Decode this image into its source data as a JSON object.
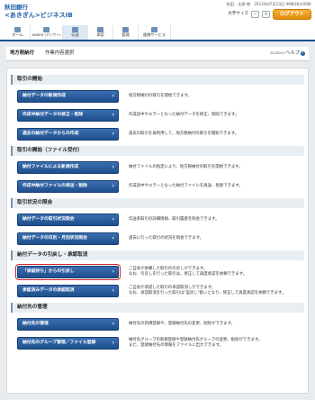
{
  "header": {
    "bank_name": "秋田銀行",
    "service_name": "<あきぎん>ビジネスIB",
    "user_line": "秋田　太郎 様　2012年07月13日 09時30分00秒",
    "font_size_label": "文字サイズ",
    "font_minus": "－",
    "font_plus": "＋",
    "logout": "ログアウト"
  },
  "nav": [
    {
      "label": "ホーム",
      "icon": "home-icon"
    },
    {
      "label": "ANSER (アンサー)",
      "icon": "anser-icon"
    },
    {
      "label": "伝送",
      "icon": "transfer-icon"
    },
    {
      "label": "承認",
      "icon": "approval-icon"
    },
    {
      "label": "管理",
      "icon": "management-icon"
    },
    {
      "label": "連携サービス",
      "icon": "link-service-icon"
    }
  ],
  "titlebar": {
    "breadcrumb": "地方税納付",
    "page_title": "作業内容選択",
    "screen_id": "BCZK001",
    "help": "ヘルプ",
    "help_icon": "?"
  },
  "sections": [
    {
      "title": "取引の開始",
      "rows": [
        {
          "button": "納付データの新規作成",
          "desc": [
            "地方税納付の取引を開始できます。"
          ]
        },
        {
          "button": "作成中納付データの修正・削除",
          "desc": [
            "作成途中やエラーとなった納付データを修正、削除できます。"
          ]
        },
        {
          "button": "過去の納付データからの作成",
          "desc": [
            "過去の取引を再利用して、地方税納付の取引を開始できます。"
          ]
        }
      ]
    },
    {
      "title": "取引の開始（ファイル受付）",
      "rows": [
        {
          "button": "納付ファイルによる新規作成",
          "desc": [
            "納付ファイルの指定により、地方税納付の取引を開始できます。"
          ]
        },
        {
          "button": "作成中納付ファイルの再送・削除",
          "desc": [
            "作成途中やエラーとなった納付ファイルを再送、削除できます。"
          ]
        }
      ]
    },
    {
      "title": "取引状況の照会",
      "rows": [
        {
          "button": "納付データの取引状況照会",
          "desc": [
            "伝送系取引の詳細情報、取引履歴を照会できます。"
          ]
        },
        {
          "button": "納付データの日別・月別状況照会",
          "desc": [
            "過去に行った取引の状況を照会できます。"
          ]
        }
      ]
    },
    {
      "title": "納付データの引戻し・承認取消",
      "rows": [
        {
          "button": "「承認待ち」からの引戻し",
          "highlight": true,
          "desc": [
            "ご自身が依頼した取引の引戻しができます。",
            "なお、引戻しを行った取引は、修正して再度承認を依頼できます。"
          ]
        },
        {
          "button": "承認済みデータの承認取消",
          "desc": [
            "ご自身が承認した取引の承認取消しができます。",
            "なお、承認取消を行った取引は\"差戻し\"扱いとなり、修正して再度承認を依頼できます。"
          ]
        }
      ]
    },
    {
      "title": "納付先の管理",
      "rows": [
        {
          "button": "納付先の管理",
          "desc": [
            "納付先の新規登録や、登録納付先の変更、削除ができます。"
          ]
        },
        {
          "button": "納付先のグループ管理／ファイル登録",
          "desc": [
            "納付先グループの新規登録や登録納付先グループの変更、削除ができます。",
            "また、登録納付先の情報をファイルに出力できます。"
          ]
        }
      ]
    }
  ]
}
